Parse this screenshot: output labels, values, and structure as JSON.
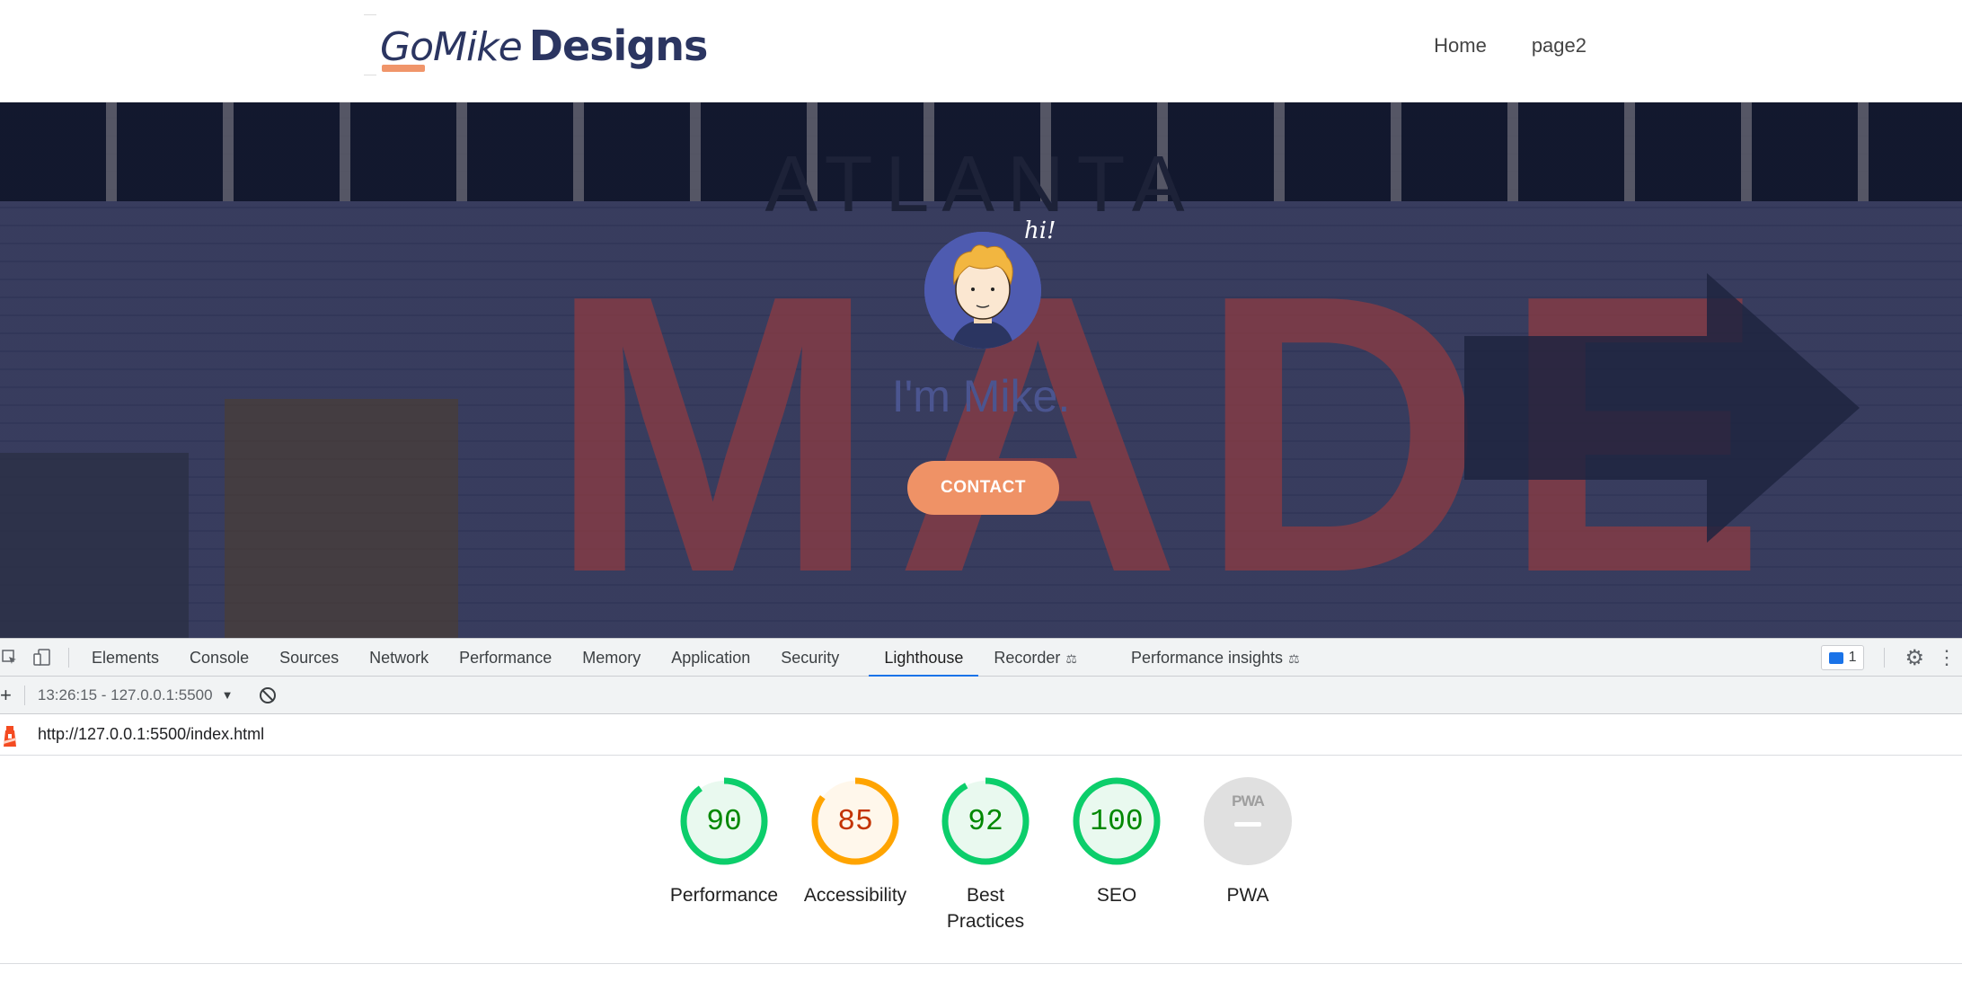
{
  "site": {
    "logo_part1": "GoMike",
    "logo_part2": "Designs",
    "nav": [
      "Home",
      "page2"
    ]
  },
  "hero": {
    "sign_text": "ATLANTA",
    "wall_text": "MADE",
    "avatar_caption": "hi!",
    "title": "I'm Mike.",
    "contact_label": "CONTACT"
  },
  "devtools": {
    "tabs": [
      "Elements",
      "Console",
      "Sources",
      "Network",
      "Performance",
      "Memory",
      "Application",
      "Security",
      "Lighthouse",
      "Recorder",
      "Performance insights"
    ],
    "active_tab": "Lighthouse",
    "issues_count": "1",
    "report_selector": "13:26:15 - 127.0.0.1:5500",
    "url": "http://127.0.0.1:5500/index.html",
    "scores": [
      {
        "label": "Performance",
        "value": "90",
        "score": 90,
        "color": "#0cce6b",
        "text_color": "#008800",
        "fill": "#e9f9ef"
      },
      {
        "label": "Accessibility",
        "value": "85",
        "score": 85,
        "color": "#ffa400",
        "text_color": "#c33300",
        "fill": "#fff7eb"
      },
      {
        "label": "Best Practices",
        "value": "92",
        "score": 92,
        "color": "#0cce6b",
        "text_color": "#008800",
        "fill": "#e9f9ef"
      },
      {
        "label": "SEO",
        "value": "100",
        "score": 100,
        "color": "#0cce6b",
        "text_color": "#008800",
        "fill": "#e9f9ef"
      },
      {
        "label": "PWA",
        "value": "PWA",
        "score": null,
        "color": "#e0e0e0",
        "text_color": "#9e9e9e",
        "fill": "#e0e0e0"
      }
    ],
    "colors": {
      "accent": "#1a73e8",
      "pass": "#0cce6b",
      "average": "#ffa400",
      "brand_orange": "#ef9266",
      "navy": "#2b3561"
    }
  }
}
